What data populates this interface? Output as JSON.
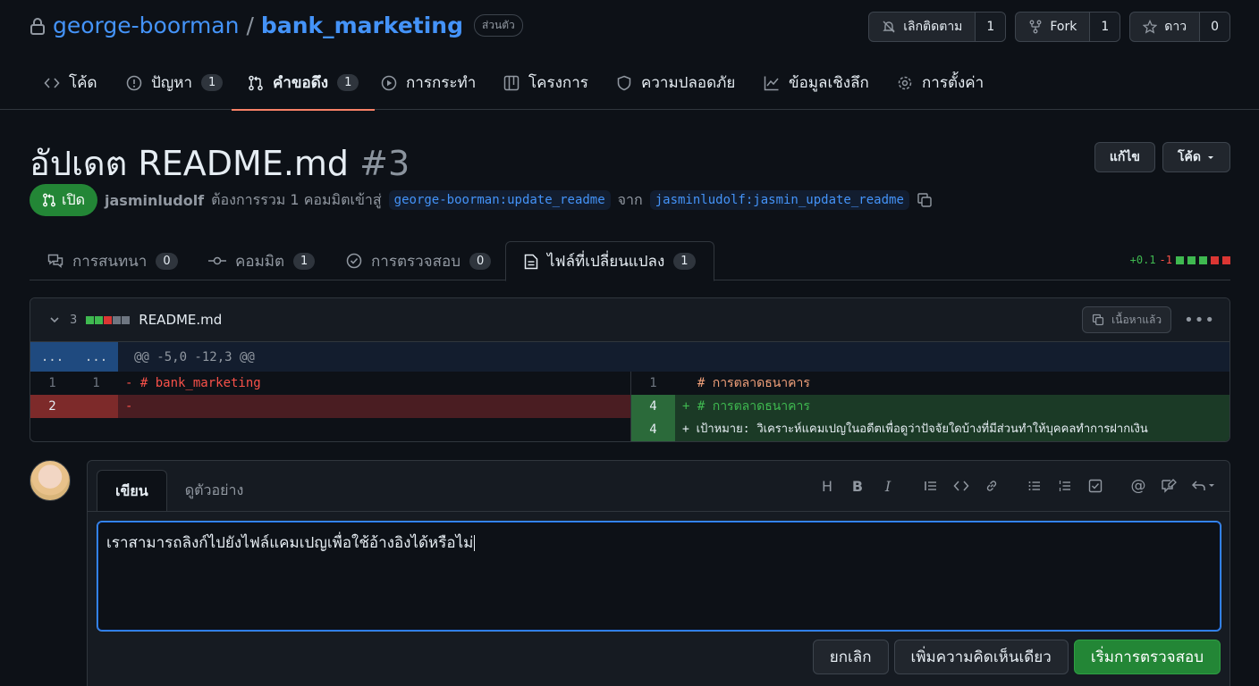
{
  "repo": {
    "owner": "george-boorman",
    "separator": "/",
    "name": "bank_marketing",
    "visibility": "ส่วนตัว",
    "actions": [
      {
        "label": "เลิกติดตาม",
        "count": "1",
        "icon": "bell-slash-icon"
      },
      {
        "label": "Fork",
        "count": "1",
        "icon": "fork-icon"
      },
      {
        "label": "ดาว",
        "count": "0",
        "icon": "star-icon"
      }
    ]
  },
  "nav": {
    "code": "โค้ด",
    "issues": "ปัญหา",
    "issues_count": "1",
    "pulls": "คำขอดึง",
    "pulls_count": "1",
    "actions": "การกระทำ",
    "projects": "โครงการ",
    "security": "ความปลอดภัย",
    "insights": "ข้อมูลเชิงลึก",
    "settings": "การตั้งค่า"
  },
  "pr": {
    "title": "อัปเดต README.md",
    "number": "#3",
    "edit_label": "แก้ไข",
    "code_label": "โค้ด",
    "state": "เปิด",
    "author": "jasminludolf",
    "merge_text": "ต้องการรวม 1 คอมมิตเข้าสู่",
    "base_branch": "george-boorman:update_readme",
    "from_text": "จาก",
    "head_branch": "jasminludolf:jasmin_update_readme"
  },
  "tabs": {
    "conversation": "การสนทนา",
    "conversation_count": "0",
    "commits": "คอมมิต",
    "commits_count": "1",
    "checks": "การตรวจสอบ",
    "checks_count": "0",
    "files": "ไฟล์ที่เปลี่ยนแปลง",
    "files_count": "1",
    "diffstat_add": "+0.1",
    "diffstat_del": "-1"
  },
  "file": {
    "count_label": "3",
    "name": "README.md",
    "viewed_label": "เนื้อหาแล้ว",
    "hunk_expander": "...",
    "hunk": "@@ -5,0 -12,3 @@",
    "left_rows": [
      {
        "old": "1",
        "new": "1",
        "text": "- # bank_marketing"
      },
      {
        "old": "2",
        "new": "",
        "text": "-"
      }
    ],
    "right_rows": [
      {
        "num": "1",
        "text": "  # การตลาดธนาคาร"
      },
      {
        "num": "4",
        "text": "+ # การตลาดธนาคาร"
      },
      {
        "num": "4",
        "text": "+ เป้าหมาย: วิเคราะห์แคมเปญในอดีตเพื่อดูว่าปัจจัยใดบ้างที่มีส่วนทำให้บุคคลทำการฝากเงิน"
      }
    ]
  },
  "comment": {
    "write_tab": "เขียน",
    "preview_tab": "ดูตัวอย่าง",
    "text": "เราสามารถลิงก์ไปยังไฟล์แคมเปญเพื่อใช้อ้างอิงได้หรือไม่",
    "cancel": "ยกเลิก",
    "single_comment": "เพิ่มความคิดเห็นเดียว",
    "start_review": "เริ่มการตรวจสอบ",
    "toolbar_heading": "H",
    "toolbar_bold": "B",
    "toolbar_italic": "I"
  },
  "colors": {
    "accent": "#4493f8",
    "open_green": "#238636",
    "deletion_red": "#f85149",
    "addition_green": "#3fb950"
  }
}
